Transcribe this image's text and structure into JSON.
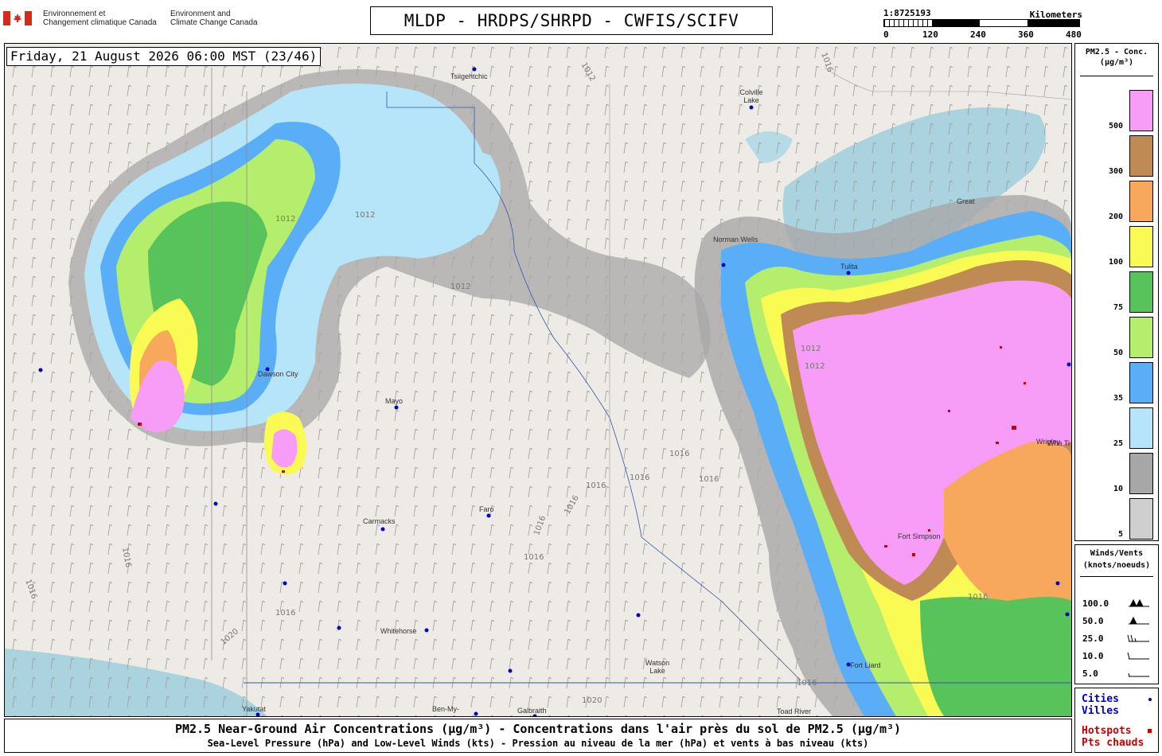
{
  "header": {
    "dept_fr": [
      "Environnement et",
      "Changement climatique Canada"
    ],
    "dept_en": [
      "Environment and",
      "Climate Change Canada"
    ],
    "title": "MLDP - HRDPS/SHRPD - CWFIS/SCIFV"
  },
  "scale": {
    "ratio": "1:8725193",
    "unit": "Kilometers",
    "ticks": [
      "0",
      "120",
      "240",
      "360",
      "480"
    ]
  },
  "map": {
    "datetime": "Friday, 21 August 2026 06:00 MST (23/46)",
    "places": [
      "Tsiigehtchic",
      "Colville Lake",
      "Great",
      "Mayo",
      "Carmacks",
      "Faro",
      "Whitehorse",
      "Watson Lake",
      "Fort Liard",
      "Yakutat",
      "Ben-My-",
      "Galbraith",
      "Toad River",
      "Fort Simpson",
      "Wrigley",
      "Dawson City",
      "Tulita",
      "Norman Wells",
      "Wha Ti"
    ],
    "isobars": [
      "1012",
      "1012",
      "1012",
      "1012",
      "1012",
      "1012",
      "1016",
      "1016",
      "1016",
      "1016",
      "1016",
      "1016",
      "1016",
      "1016",
      "1016",
      "1016",
      "1016",
      "1016",
      "1016",
      "1020",
      "1020"
    ]
  },
  "legend_pm25": {
    "title": [
      "PM2.5 - Conc.",
      "(µg/m³)"
    ],
    "levels": [
      {
        "label": "500",
        "color": "#f79cf7"
      },
      {
        "label": "300",
        "color": "#c08a55"
      },
      {
        "label": "200",
        "color": "#f8a85c"
      },
      {
        "label": "100",
        "color": "#fafa55"
      },
      {
        "label": "75",
        "color": "#58c35a"
      },
      {
        "label": "50",
        "color": "#b4ee6c"
      },
      {
        "label": "35",
        "color": "#5aadf7"
      },
      {
        "label": "25",
        "color": "#b6e5f9"
      },
      {
        "label": "10",
        "color": "#a7a7a7"
      },
      {
        "label": "5",
        "color": "#cfcfcf"
      }
    ]
  },
  "legend_winds": {
    "title": [
      "Winds/Vents",
      "(knots/noeuds)"
    ],
    "speeds": [
      "100.0",
      "50.0",
      "25.0",
      "10.0",
      "5.0"
    ]
  },
  "legend_points": {
    "cities": [
      "Cities",
      "Villes"
    ],
    "hotspots": [
      "Hotspots",
      "Pts chauds"
    ],
    "cities_color": "#0000cc",
    "hotspots_color": "#cc0000"
  },
  "footer": {
    "line1": "PM2.5 Near-Ground Air Concentrations (µg/m³) - Concentrations dans l'air près du sol de PM2.5 (µg/m³)",
    "line2": "Sea-Level Pressure (hPa) and Low-Level Winds (kts) - Pression au niveau de la mer (hPa) et vents à bas niveau (kts)"
  }
}
